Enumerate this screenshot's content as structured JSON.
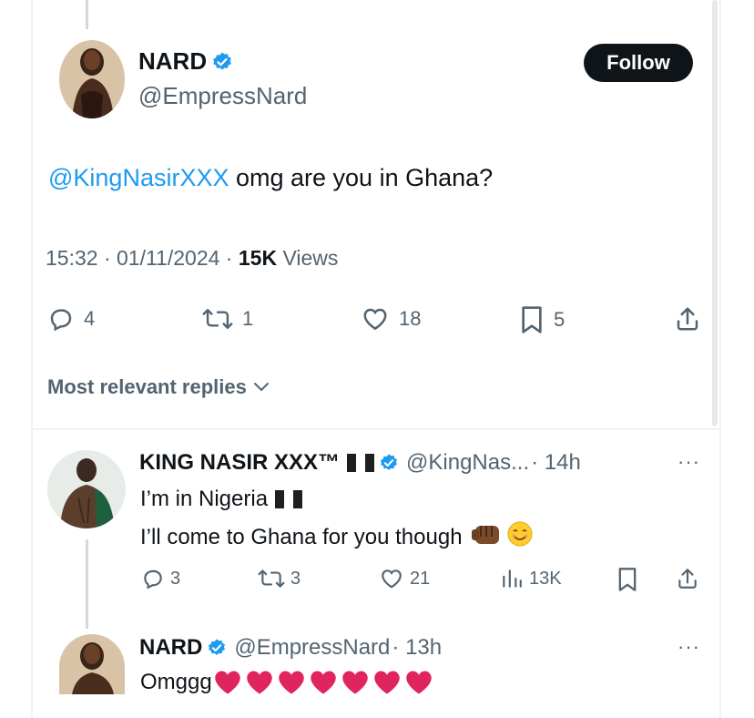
{
  "main_tweet": {
    "author_name": "NARD",
    "author_handle": "@EmpressNard",
    "follow_label": "Follow",
    "mention": "@KingNasirXXX",
    "text": " omg are you in Ghana?",
    "time": "15:32",
    "date": "· 01/11/2024 ·",
    "views_count": "15K",
    "views_label": "Views",
    "replies": "4",
    "reposts": "1",
    "likes": "18",
    "bookmarks": "5"
  },
  "sort": {
    "label": "Most relevant replies"
  },
  "reply_1": {
    "author_name": "KING NASIR XXX™",
    "author_handle": "@KingNas...",
    "time": "· 14h",
    "line1": "I’m in Nigeria",
    "line2": "I’ll come to Ghana for you though",
    "replies": "3",
    "reposts": "3",
    "likes": "21",
    "views": "13K",
    "more": "···"
  },
  "reply_2": {
    "author_name": "NARD",
    "author_handle": "@EmpressNard",
    "time": "· 13h",
    "text": "Omggg",
    "more": "···"
  },
  "colors": {
    "accent": "#1d9bf0",
    "text_primary": "#0f1419",
    "text_secondary": "#536471",
    "heart": "#e0245e"
  },
  "icons": [
    "verified-badge-icon",
    "reply-icon",
    "repost-icon",
    "like-icon",
    "bookmark-icon",
    "share-icon",
    "views-icon",
    "chevron-down-icon",
    "more-icon",
    "nigeria-flag-icon",
    "fist-emoji-icon",
    "smile-emoji-icon",
    "red-heart-icon"
  ]
}
